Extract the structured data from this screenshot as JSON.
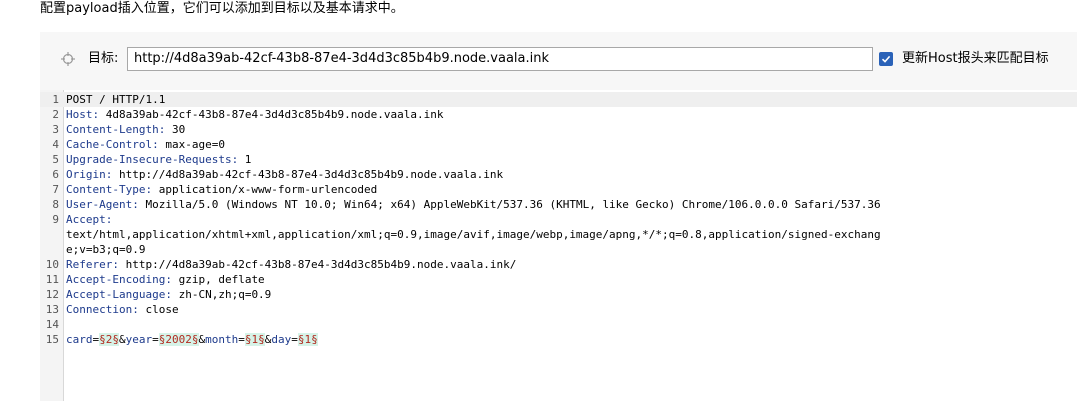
{
  "description": "配置payload插入位置，它们可以添加到目标以及基本请求中。",
  "target": {
    "label": "目标:",
    "url": "http://4d8a39ab-42cf-43b8-87e4-3d4d3c85b4b9.node.vaala.ink",
    "update_host_label": "更新Host报头来匹配目标",
    "update_host_checked": true
  },
  "editor": {
    "line_numbers": [
      "1",
      "2",
      "3",
      "4",
      "5",
      "6",
      "7",
      "8",
      "9",
      "",
      "",
      "10",
      "11",
      "12",
      "13",
      "14",
      "15"
    ],
    "request_line": "POST / HTTP/1.1",
    "headers": [
      {
        "name": "Host:",
        "value": " 4d8a39ab-42cf-43b8-87e4-3d4d3c85b4b9.node.vaala.ink"
      },
      {
        "name": "Content-Length:",
        "value": " 30"
      },
      {
        "name": "Cache-Control:",
        "value": " max-age=0"
      },
      {
        "name": "Upgrade-Insecure-Requests:",
        "value": " 1"
      },
      {
        "name": "Origin:",
        "value": " http://4d8a39ab-42cf-43b8-87e4-3d4d3c85b4b9.node.vaala.ink"
      },
      {
        "name": "Content-Type:",
        "value": " application/x-www-form-urlencoded"
      },
      {
        "name": "User-Agent:",
        "value": " Mozilla/5.0 (Windows NT 10.0; Win64; x64) AppleWebKit/537.36 (KHTML, like Gecko) Chrome/106.0.0.0 Safari/537.36"
      },
      {
        "name": "Accept:",
        "value": ""
      }
    ],
    "accept_wrap_1": "text/html,application/xhtml+xml,application/xml;q=0.9,image/avif,image/webp,image/apng,*/*;q=0.8,application/signed-exchang",
    "accept_wrap_2": "e;v=b3;q=0.9",
    "headers2": [
      {
        "name": "Referer:",
        "value": " http://4d8a39ab-42cf-43b8-87e4-3d4d3c85b4b9.node.vaala.ink/"
      },
      {
        "name": "Accept-Encoding:",
        "value": " gzip, deflate"
      },
      {
        "name": "Accept-Language:",
        "value": " zh-CN,zh;q=0.9"
      },
      {
        "name": "Connection:",
        "value": " close"
      }
    ],
    "body": {
      "p1_name": "card",
      "p1_eq": "=",
      "p1_mark": "§2§",
      "amp1": "&",
      "p2_name": "year",
      "p2_eq": "=",
      "p2_mark": "§2002§",
      "amp2": "&",
      "p3_name": "month",
      "p3_eq": "=",
      "p3_mark": "§1§",
      "amp3": "&",
      "p4_name": "day",
      "p4_eq": "=",
      "p4_mark": "§1§"
    }
  },
  "colors": {
    "header_name": "#1d3a8c",
    "payload_marker_text": "#b22b20",
    "payload_marker_bg": "#d6f3e8",
    "checkbox": "#2a62b8"
  }
}
